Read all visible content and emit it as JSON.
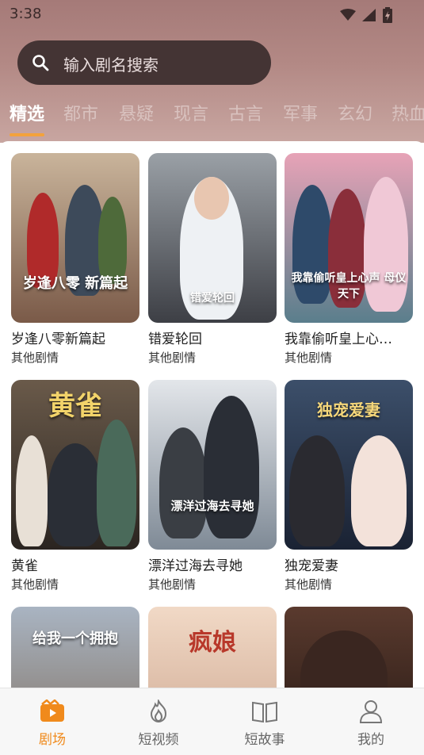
{
  "status_bar": {
    "time": "3:38"
  },
  "search": {
    "placeholder": "输入剧名搜索"
  },
  "tabs": [
    "精选",
    "都市",
    "悬疑",
    "现言",
    "古言",
    "军事",
    "玄幻",
    "热血"
  ],
  "posters": [
    {
      "title": "岁逢八零新篇起",
      "category": "其他剧情",
      "overlay": "岁逢八零 新篇起",
      "colors": [
        "#c9b49b",
        "#7a5a48"
      ]
    },
    {
      "title": "错爱轮回",
      "category": "其他剧情",
      "overlay": "错爱轮回",
      "colors": [
        "#9aa0a6",
        "#3d3f45"
      ]
    },
    {
      "title": "我靠偷听皇上心…",
      "category": "其他剧情",
      "overlay": "我靠偷听皇上心声 母仪天下",
      "colors": [
        "#e7a3b7",
        "#5a7e8c"
      ]
    },
    {
      "title": "黄雀",
      "category": "其他剧情",
      "overlay": "黄雀",
      "colors": [
        "#6a5a4a",
        "#2a2420"
      ]
    },
    {
      "title": "漂洋过海去寻她",
      "category": "其他剧情",
      "overlay": "漂洋过海去寻她",
      "colors": [
        "#e3e6ea",
        "#7f8a96"
      ]
    },
    {
      "title": "独宠爱妻",
      "category": "其他剧情",
      "overlay": "独宠爱妻",
      "colors": [
        "#3c4f6a",
        "#1a2233"
      ]
    },
    {
      "title": "",
      "category": "",
      "overlay": "给我一个拥抱",
      "colors": [
        "#a9b4c2",
        "#7c6a58"
      ]
    },
    {
      "title": "",
      "category": "",
      "overlay": "疯娘",
      "colors": [
        "#f1d9c6",
        "#c9a18a"
      ]
    },
    {
      "title": "",
      "category": "",
      "overlay": "",
      "colors": [
        "#5a3a2e",
        "#1e1410"
      ]
    }
  ],
  "bottom_nav": [
    {
      "label": "剧场",
      "icon": "theater-icon",
      "active": true
    },
    {
      "label": "短视频",
      "icon": "flame-icon",
      "active": false
    },
    {
      "label": "短故事",
      "icon": "book-icon",
      "active": false
    },
    {
      "label": "我的",
      "icon": "profile-icon",
      "active": false
    }
  ],
  "colors": {
    "accent": "#f08a1c",
    "header": "#b38985",
    "search_bg": "#443434"
  }
}
